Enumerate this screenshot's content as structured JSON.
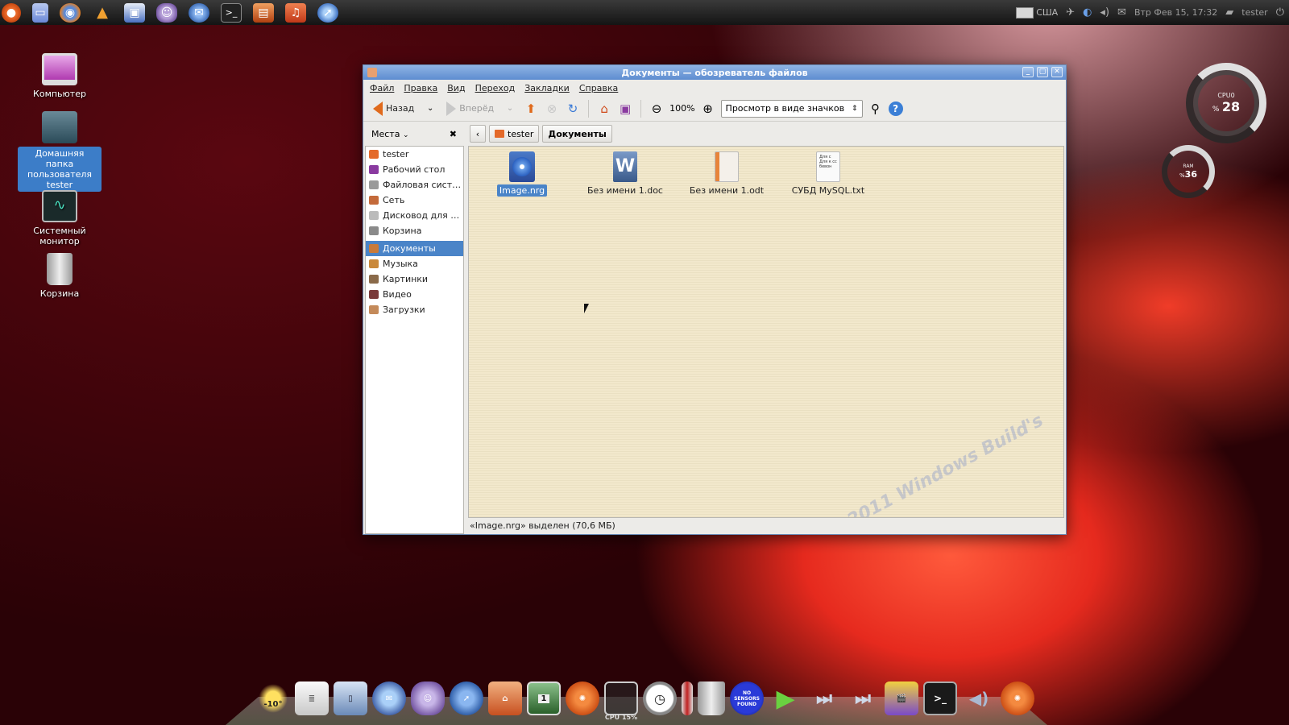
{
  "top_panel": {
    "launchers": [
      "ubuntu-menu-icon",
      "files-icon",
      "firefox-icon",
      "vlc-icon",
      "image-viewer-icon",
      "pidgin-icon",
      "thunderbird-icon",
      "terminal-icon",
      "archive-icon",
      "clementine-icon",
      "web-browser-icon"
    ],
    "keyboard_layout": "США",
    "datetime": "Втр Фев 15, 17:32",
    "user": "tester"
  },
  "desktop": {
    "icons": [
      {
        "label": "Компьютер"
      },
      {
        "label": "Домашняя папка пользователя tester"
      },
      {
        "label": "Системный монитор"
      },
      {
        "label": "Корзина"
      }
    ]
  },
  "gauges": {
    "cpu": {
      "title": "CPU0",
      "prefix": "%",
      "value": "28"
    },
    "ram": {
      "title": "RAM",
      "prefix": "%",
      "value": "36"
    }
  },
  "window": {
    "title": "Документы — обозреватель файлов",
    "menu": [
      "Файл",
      "Правка",
      "Вид",
      "Переход",
      "Закладки",
      "Справка"
    ],
    "toolbar": {
      "back": "Назад",
      "forward": "Вперёд",
      "zoom": "100%",
      "view_mode": "Просмотр в виде значков"
    },
    "places_label": "Места",
    "breadcrumb": [
      "tester",
      "Документы"
    ],
    "sidebar": [
      {
        "label": "tester",
        "color": "#e46a2a"
      },
      {
        "label": "Рабочий стол",
        "color": "#8a3aa0"
      },
      {
        "label": "Файловая сист…",
        "color": "#9a9a9a"
      },
      {
        "label": "Сеть",
        "color": "#c46a3a"
      },
      {
        "label": "Дисковод для …",
        "color": "#bbbbbb"
      },
      {
        "label": "Корзина",
        "color": "#8a8a8a"
      },
      {
        "label": "Документы",
        "color": "#c97a3a"
      },
      {
        "label": "Музыка",
        "color": "#c9883a"
      },
      {
        "label": "Картинки",
        "color": "#8a6a4a"
      },
      {
        "label": "Видео",
        "color": "#7a3a3a"
      },
      {
        "label": "Загрузки",
        "color": "#c48a5a"
      }
    ],
    "files": [
      {
        "name": "Image.nrg",
        "icon": "disc-image-icon"
      },
      {
        "name": "Без имени 1.doc",
        "icon": "word-document-icon"
      },
      {
        "name": "Без имени 1.odt",
        "icon": "text-document-icon"
      },
      {
        "name": "СУБД MySQL.txt",
        "icon": "text-file-icon",
        "preview": "Для с Для к сс бевон"
      }
    ],
    "status": "«Image.nrg» выделен (70,6 МБ)",
    "watermark": "©2011 Windows Build's"
  },
  "dock": {
    "weather": "-10°",
    "cpu_label": "CPU 15%",
    "sensors": "NO SENSORS FOUND",
    "workspace": "1"
  },
  "colors": {
    "selection": "#4a84c8",
    "titlebar": "#5d8cd0",
    "content_bg": "#f2e8cc"
  }
}
